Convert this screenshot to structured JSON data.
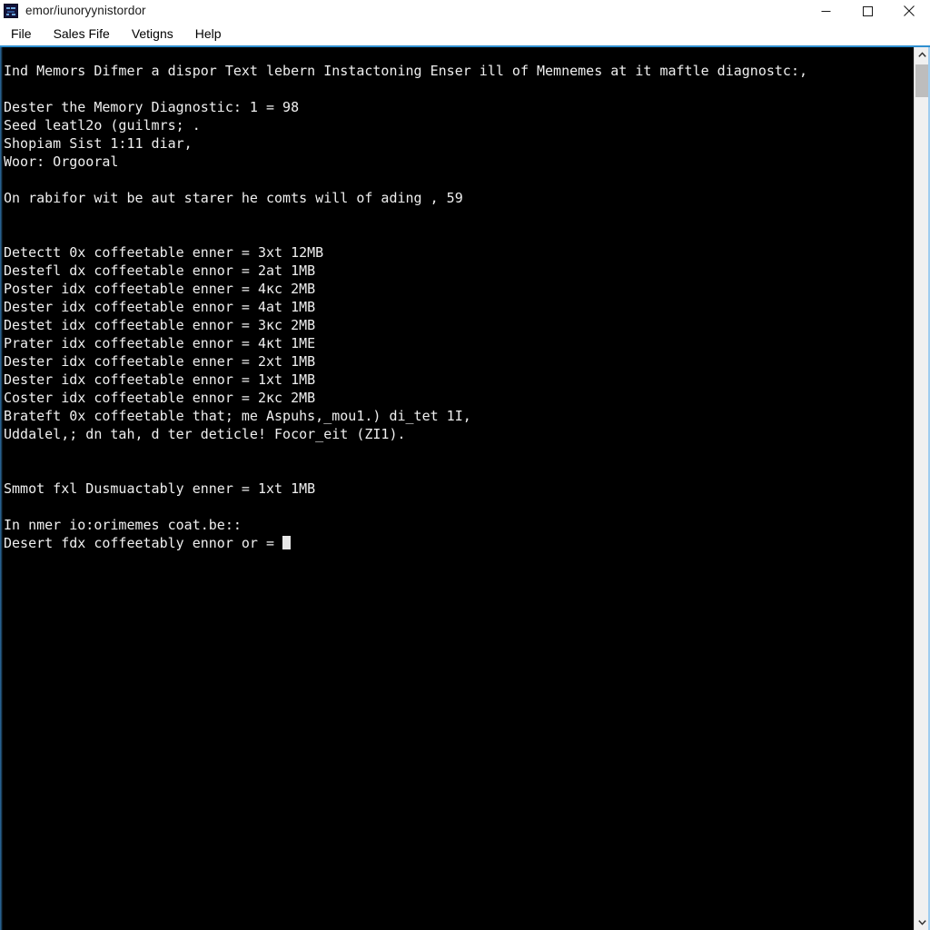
{
  "window": {
    "title": "emor/iunoryynistordor",
    "icon_name": "app-icon",
    "minimize_label": "Minimize",
    "maximize_label": "Maximize",
    "close_label": "Close"
  },
  "menubar": {
    "items": [
      {
        "label": "File"
      },
      {
        "label": "Sales Fife"
      },
      {
        "label": "Vetigns"
      },
      {
        "label": "Help"
      }
    ]
  },
  "terminal": {
    "background": "#000000",
    "foreground": "#efefef",
    "accent": "#2f8fd0",
    "lines": [
      "Ind Memors Difmer a dispor Text lebern Instactoning Enser ill of Memnemes at it maftle diagnostc:,",
      "",
      "Dester the Memory Diagnostic: 1 = 98",
      "Seed leatl2o (guilmrs; .",
      "Shopiam Sist 1:11 diar,",
      "Woor: Orgooral",
      "",
      "On rabifor wit be aut starer he comts will of ading , 59",
      "",
      "",
      "Detectt 0x coffeetable enner = 3xt 12MB",
      "Destefl dx coffeetable ennor = 2at 1MB",
      "Poster idx coffeetable enner = 4кc 2MB",
      "Dester idx coffeetable ennor = 4at 1MB",
      "Destet idx coffeetable ennor = 3кc 2MB",
      "Prater idx coffeetable ennor = 4кt 1ME",
      "Dester idx coffeetable enner = 2xt 1MB",
      "Dester idx coffeetable ennor = 1xt 1MB",
      "Coster idx coffeetable ennor = 2кc 2MB",
      "Brateft 0x coffeetable that; me Aspuhs,_mou1.) di_tet 1I,",
      "Uddalel,; dn tah, d ter deticle! Focor_eit (ZI1).",
      "",
      "",
      "Smmot fxl Dusmuactably enner = 1xt 1MB",
      "",
      "In nmer io:orimemes coat.be::"
    ],
    "prompt_line": "Desert fdx coffeetably ennor or = ",
    "cursor": "block"
  },
  "scrollbar": {
    "up_arrow_name": "scroll-up-arrow",
    "down_arrow_name": "scroll-down-arrow",
    "thumb_name": "scroll-thumb"
  }
}
